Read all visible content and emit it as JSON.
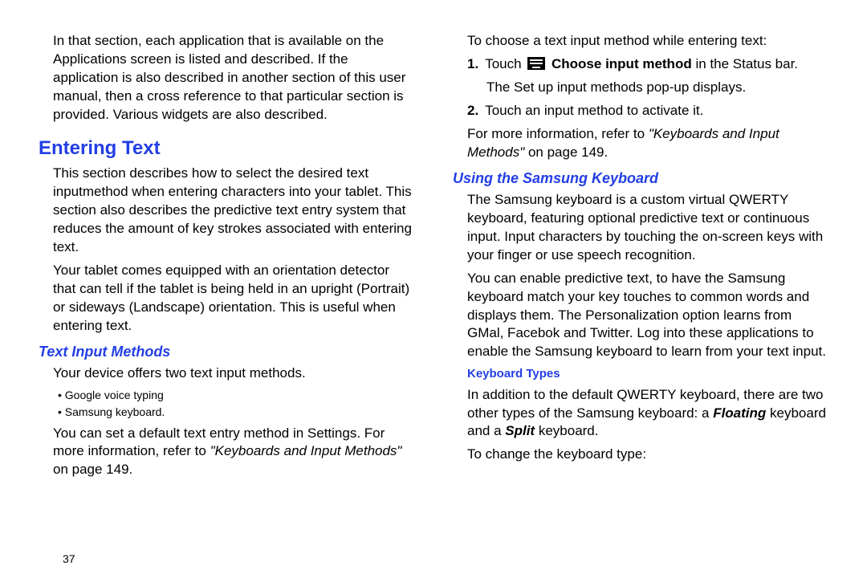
{
  "left": {
    "intro": "In that section, each application that is available on the Applications screen is listed and described. If the application is also described in another section of this user manual, then a cross reference to that particular section is provided. Various widgets are also described.",
    "h1": "Entering Text",
    "sec1p1": "This section describes how to select the desired text inputmethod when entering characters into your tablet. This section also describes the predictive text entry system that reduces the amount of key strokes associated with entering text.",
    "sec1p2": "Your tablet comes equipped with an orientation detector that can tell if the tablet is being held in an upright (Portrait) or sideways (Landscape) orientation. This is useful when entering text.",
    "h2a": "Text Input Methods",
    "tim_intro": "Your device offers two text input methods.",
    "tim_b1": "Google voice typing",
    "tim_b2": "Samsung keyboard.",
    "tim_after_pre": "You can set a default text entry method in Settings. For more information, refer to ",
    "tim_after_ref": "\"Keyboards and Input Methods\"",
    "tim_after_post": " on page 149."
  },
  "right": {
    "choose_intro": "To choose a text input method while entering text:",
    "step1_num": "1.",
    "step1_pre": "Touch ",
    "step1_bold": " Choose input method",
    "step1_post": " in the Status bar.",
    "step1_line2": "The Set up input methods pop-up displays.",
    "step2_num": "2.",
    "step2_text": "Touch an input method to activate it.",
    "more_pre": "For more information, refer to ",
    "more_ref": "\"Keyboards and Input Methods\"",
    "more_post": " on page 149.",
    "h2b": "Using the Samsung Keyboard",
    "usk_p1": "The Samsung keyboard is a custom virtual QWERTY keyboard, featuring optional predictive text or continuous input. Input characters by touching the on-screen keys with your finger or use speech recognition.",
    "usk_p2": "You can enable predictive text, to have the Samsung keyboard match your key touches to common words and displays them. The Personalization option learns from GMal, Facebok and Twitter. Log into these applications to enable the Samsung keyboard to learn from your text input.",
    "h3": "Keyboard Types",
    "kt_pre": "In addition to the default QWERTY keyboard, there are two other types of the Samsung keyboard: a ",
    "kt_float": "Floating",
    "kt_mid": " keyboard and a ",
    "kt_split": "Split",
    "kt_post": " keyboard.",
    "kt_change": "To change the keyboard type:"
  },
  "pagenum": "37"
}
